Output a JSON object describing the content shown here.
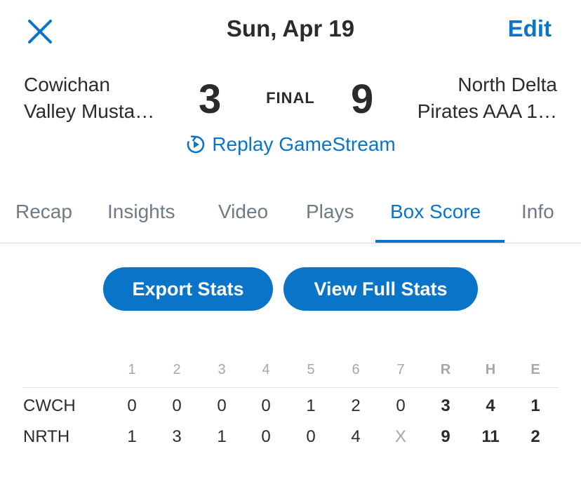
{
  "header": {
    "close_icon": "close-icon",
    "date": "Sun, Apr 19",
    "edit_label": "Edit",
    "accent_color": "#0a74c9"
  },
  "game": {
    "away_team_line1": "Cowichan",
    "away_team_line2": "Valley Musta…",
    "away_score": "3",
    "status": "FINAL",
    "home_score": "9",
    "home_team_line1": "North Delta",
    "home_team_line2": "Pirates AAA 1…",
    "replay_icon": "replay-icon",
    "replay_label": "Replay GameStream"
  },
  "tabs": [
    {
      "label": "Recap",
      "active": false
    },
    {
      "label": "Insights",
      "active": false
    },
    {
      "label": "Video",
      "active": false
    },
    {
      "label": "Plays",
      "active": false
    },
    {
      "label": "Box Score",
      "active": true
    },
    {
      "label": "Info",
      "active": false
    }
  ],
  "actions": {
    "export_label": "Export Stats",
    "full_stats_label": "View Full Stats"
  },
  "box_score": {
    "headers": [
      "1",
      "2",
      "3",
      "4",
      "5",
      "6",
      "7",
      "R",
      "H",
      "E"
    ],
    "rows": [
      {
        "team": "CWCH",
        "cells": [
          "0",
          "0",
          "0",
          "0",
          "1",
          "2",
          "0",
          "3",
          "4",
          "1"
        ]
      },
      {
        "team": "NRTH",
        "cells": [
          "1",
          "3",
          "1",
          "0",
          "0",
          "4",
          "X",
          "9",
          "11",
          "2"
        ]
      }
    ]
  }
}
